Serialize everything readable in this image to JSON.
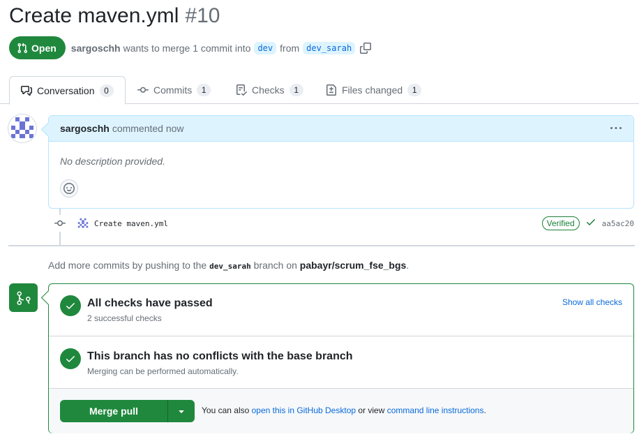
{
  "header": {
    "title": "Create maven.yml",
    "number": "#10"
  },
  "meta": {
    "state": "Open",
    "author": "sargoschh",
    "text_before_base": "wants to merge 1 commit into",
    "base_branch": "dev",
    "text_from": "from",
    "head_branch": "dev_sarah"
  },
  "tabs": [
    {
      "label": "Conversation",
      "count": "0",
      "icon": "comment-discussion-icon"
    },
    {
      "label": "Commits",
      "count": "1",
      "icon": "git-commit-icon"
    },
    {
      "label": "Checks",
      "count": "1",
      "icon": "checklist-icon"
    },
    {
      "label": "Files changed",
      "count": "1",
      "icon": "file-diff-icon"
    }
  ],
  "comment": {
    "author": "sargoschh",
    "action": "commented now",
    "body": "No description provided."
  },
  "commit": {
    "message": "Create maven.yml",
    "verified": "Verified",
    "sha": "aa5ac20"
  },
  "hint": {
    "prefix": "Add more commits by pushing to the",
    "branch": "dev_sarah",
    "middle": "branch on",
    "repo": "pabayr/scrum_fse_bgs",
    "suffix": "."
  },
  "merge": {
    "checks_title": "All checks have passed",
    "checks_sub": "2 successful checks",
    "show_all": "Show all checks",
    "conflicts_title": "This branch has no conflicts with the base branch",
    "conflicts_sub": "Merging can be performed automatically.",
    "button": "Merge pull request",
    "alt_prefix": "You can also",
    "alt_link1": "open this in GitHub Desktop",
    "alt_middle": "or view",
    "alt_link2": "command line instructions",
    "alt_suffix": "."
  },
  "colors": {
    "success": "#1f883d",
    "link": "#0969da",
    "comment_header_bg": "#ddf4ff"
  }
}
